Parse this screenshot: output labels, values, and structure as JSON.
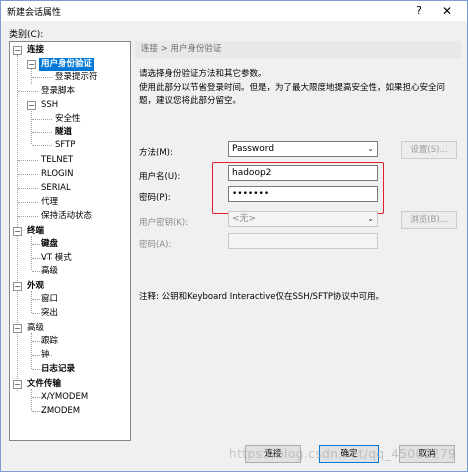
{
  "window": {
    "title": "新建会话属性",
    "help": "?",
    "close": "✕"
  },
  "category_label": "类别(C):",
  "tree": {
    "connection": "连接",
    "user_auth": "用户身份验证",
    "login_prompt": "登录提示符",
    "login_script": "登录脚本",
    "ssh": "SSH",
    "security": "安全性",
    "tunnel": "隧道",
    "sftp": "SFTP",
    "telnet": "TELNET",
    "rlogin": "RLOGIN",
    "serial": "SERIAL",
    "proxy": "代理",
    "keepalive": "保持活动状态",
    "terminal": "终端",
    "keyboard": "键盘",
    "vt_mode": "VT 模式",
    "advanced1": "高级",
    "appearance": "外观",
    "window": "窗口",
    "highlight": "突出",
    "advanced": "高级",
    "trace": "跟踪",
    "bell": "钟",
    "logging": "日志记录",
    "file_transfer": "文件传输",
    "xymodem": "X/YMODEM",
    "zmodem": "ZMODEM"
  },
  "panel": {
    "breadcrumb": "连接 > 用户身份验证",
    "desc1": "请选择身份验证方法和其它参数。",
    "desc2": "使用此部分以节省登录时间。但是，为了最大限度地提高安全性，如果担心安全问题，建议您将此部分留空。",
    "method_label": "方法(M):",
    "method_value": "Password",
    "settings_btn": "设置(S)...",
    "username_label": "用户名(U):",
    "username_value": "hadoop2",
    "password_label": "密码(P):",
    "password_value": "•••••••",
    "user_key_label": "用户密钥(K):",
    "user_key_value": "<无>",
    "browse_btn": "浏览(B)...",
    "passphrase_label": "密码(A):",
    "note": "注释: 公钥和Keyboard Interactive仅在SSH/SFTP协议中可用。"
  },
  "buttons": {
    "connect": "连接",
    "ok": "确定",
    "cancel": "取消"
  },
  "watermark": "https://blog.csdn.net/qq_45002279",
  "colors": {
    "highlight": "#e0202c",
    "selection": "#0078d7"
  }
}
